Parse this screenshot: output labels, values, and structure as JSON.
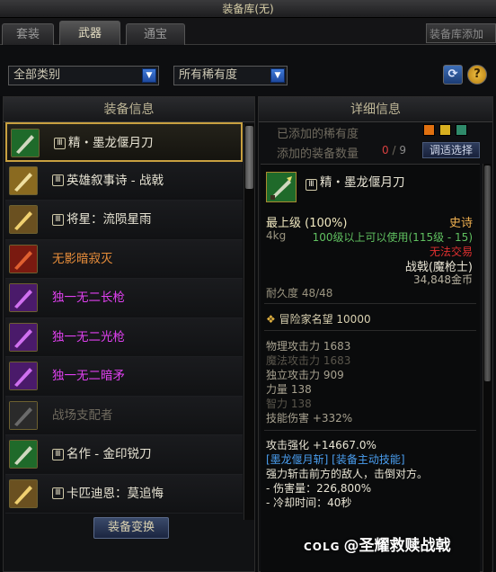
{
  "window": {
    "title": "装备库(无)"
  },
  "tabs": [
    {
      "label": "套装"
    },
    {
      "label": "武器"
    },
    {
      "label": "通宝"
    }
  ],
  "tab_right": {
    "label": "装备库添加"
  },
  "filters": {
    "category": "全部类别",
    "rarity": "所有稀有度"
  },
  "left_panel": {
    "header": "装备信息",
    "items": [
      {
        "name": "精・墨龙偃月刀",
        "tier": "Ⅲ",
        "color": "white",
        "icon": "sword-icon"
      },
      {
        "name": "英雄叙事诗 - 战戟",
        "tier": "Ⅲ",
        "color": "white",
        "icon": "halberd-icon"
      },
      {
        "name": "将星：流陨星雨",
        "tier": "Ⅲ",
        "color": "white",
        "icon": "spear-icon"
      },
      {
        "name": "无影暗寂灭",
        "tier": "",
        "color": "orange",
        "icon": "blade-icon"
      },
      {
        "name": "独一无二长枪",
        "tier": "",
        "color": "purple",
        "icon": "lance-icon"
      },
      {
        "name": "独一无二光枪",
        "tier": "",
        "color": "purple",
        "icon": "lance-icon"
      },
      {
        "name": "独一无二暗矛",
        "tier": "",
        "color": "purple",
        "icon": "lance-icon"
      },
      {
        "name": "战场支配者",
        "tier": "",
        "color": "gray",
        "icon": "axe-icon"
      },
      {
        "name": "名作 - 金印锐刀",
        "tier": "Ⅲ",
        "color": "white",
        "icon": "sword-icon"
      },
      {
        "name": "卡匹迪恩：莫追悔",
        "tier": "Ⅲ",
        "color": "white",
        "icon": "spear-icon"
      }
    ],
    "exchange_button": "装备变换"
  },
  "right_panel": {
    "header": "详细信息",
    "added_rarity_label": "已添加的稀有度",
    "added_count_label": "添加的装备数量",
    "added_count": "0",
    "count_sep": "/",
    "count_total": "9",
    "adjust_button": "调适选择",
    "rarity_swatches": [
      "#e07010",
      "#d8b020",
      "#2f8a6a"
    ],
    "detail": {
      "name": "精・墨龙偃月刀",
      "tier": "Ⅲ",
      "grade": "最上级 (100%)",
      "rarity": "史诗",
      "weight": "4kg",
      "level_req": "100级以上可以使用(115级 - 15)",
      "trade": "无法交易",
      "type": "战戟(魔枪士)",
      "price": "34,848金币",
      "durability": "耐久度 48/48",
      "fame": "冒险家名望 10000",
      "stats": [
        {
          "text": "物理攻击力 1683",
          "dim": false
        },
        {
          "text": "魔法攻击力 1683",
          "dim": true
        },
        {
          "text": "独立攻击力 909",
          "dim": false
        },
        {
          "text": "力量 138",
          "dim": false
        },
        {
          "text": "智力 138",
          "dim": true
        },
        {
          "text": "技能伤害 +332%",
          "dim": false
        }
      ],
      "enhance": "攻击强化 +14667.0%",
      "skill_title": "[墨龙偃月斩] [装备主动技能]",
      "skill_desc": "强力斩击前方的敌人，击倒对方。",
      "skill_damage": "- 伤害量：226,800%",
      "skill_cooldown": "- 冷却时间：40秒"
    }
  },
  "watermark": {
    "logo": "COLG",
    "text": "@圣耀救赎战戟"
  }
}
